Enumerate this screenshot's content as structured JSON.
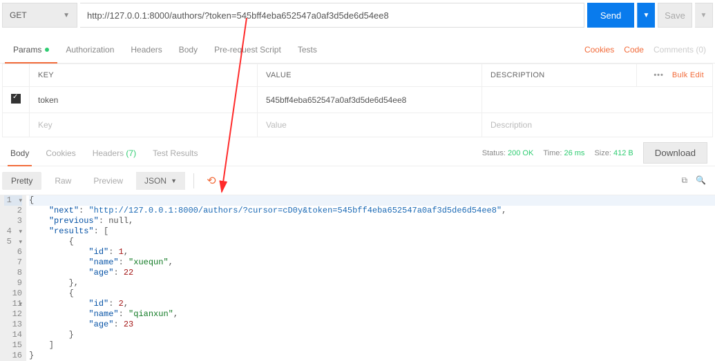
{
  "request": {
    "method": "GET",
    "url": "http://127.0.0.1:8000/authors/?token=545bff4eba652547a0af3d5de6d54ee8",
    "send_label": "Send",
    "save_label": "Save"
  },
  "tabs": {
    "params": "Params",
    "authorization": "Authorization",
    "headers": "Headers",
    "body": "Body",
    "prerequest": "Pre-request Script",
    "tests": "Tests",
    "right": {
      "cookies": "Cookies",
      "code": "Code",
      "comments": "Comments (0)"
    }
  },
  "params_table": {
    "headers": {
      "key": "KEY",
      "value": "VALUE",
      "description": "DESCRIPTION",
      "bulk": "Bulk Edit"
    },
    "rows": [
      {
        "enabled": true,
        "key": "token",
        "value": "545bff4eba652547a0af3d5de6d54ee8",
        "description": ""
      }
    ],
    "placeholders": {
      "key": "Key",
      "value": "Value",
      "description": "Description"
    }
  },
  "response_tabs": {
    "body": "Body",
    "cookies": "Cookies",
    "headers": "Headers",
    "headers_count": "(7)",
    "test_results": "Test Results"
  },
  "status_bar": {
    "status_label": "Status:",
    "status_value": "200 OK",
    "time_label": "Time:",
    "time_value": "26 ms",
    "size_label": "Size:",
    "size_value": "412 B",
    "download": "Download"
  },
  "view": {
    "pretty": "Pretty",
    "raw": "Raw",
    "preview": "Preview",
    "format": "JSON"
  },
  "response_body": {
    "next": "http://127.0.0.1:8000/authors/?cursor=cD0y&token=545bff4eba652547a0af3d5de6d54ee8",
    "previous": null,
    "results": [
      {
        "id": 1,
        "name": "xuequn",
        "age": 22
      },
      {
        "id": 2,
        "name": "qianxun",
        "age": 23
      }
    ]
  }
}
